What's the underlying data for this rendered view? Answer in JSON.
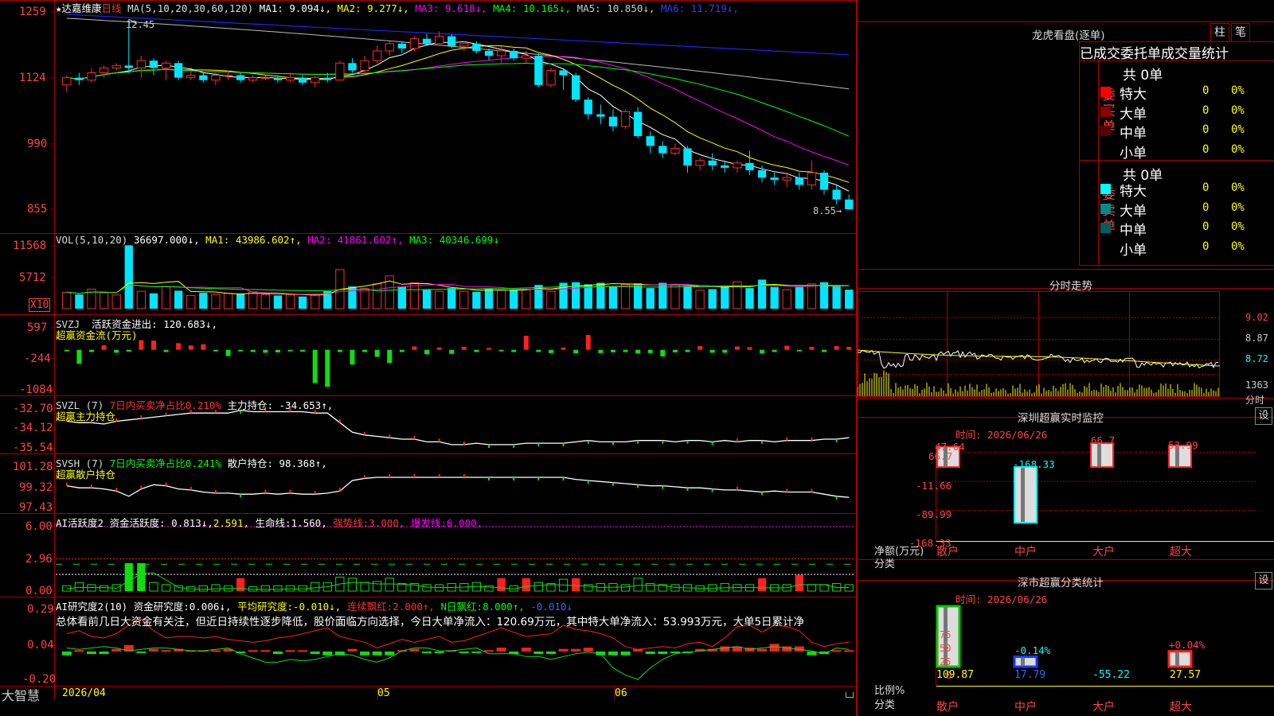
{
  "header": {
    "star": "★",
    "stock_name": "达嘉维康",
    "period": "日线",
    "ma_text": "MA(5,10,20,30,60,120)",
    "ma_values": [
      {
        "label": "MA1:",
        "value": "9.094↓",
        "color": "#ffffff"
      },
      {
        "label": "MA2:",
        "value": "9.277↓",
        "color": "#ffff00"
      },
      {
        "label": "MA3:",
        "value": "9.618↓",
        "color": "#ff00ff"
      },
      {
        "label": "MA4:",
        "value": "10.165↓",
        "color": "#00ff00"
      },
      {
        "label": "MA5:",
        "value": "10.850↓",
        "color": "#cccccc"
      },
      {
        "label": "MA6:",
        "value": "11.719↓",
        "color": "#3a3aff"
      }
    ],
    "high_label": "12.45",
    "low_label": "8.55→"
  },
  "axes": {
    "price_ticks": [
      "1259",
      "1124",
      "990",
      "855"
    ],
    "vol_ticks": [
      "11568",
      "5712"
    ],
    "vol_unit": "X10",
    "svzj_ticks": [
      "597",
      "-244",
      "-1084"
    ],
    "svzl_ticks": [
      "-32.70",
      "-34.12",
      "-35.54"
    ],
    "svsh_ticks": [
      "101.28",
      "99.32",
      "97.43"
    ],
    "ai1_ticks": [
      "6.00",
      "2.96",
      "0.00"
    ],
    "ai2_ticks": [
      "0.29",
      "0.04",
      "-0.20"
    ],
    "dates": [
      "2026/04",
      "05",
      "06"
    ]
  },
  "vol_header": {
    "text": "VOL(5,10,20)",
    "value": "36697.000↓,",
    "items": [
      {
        "label": "MA1:",
        "value": "43986.602↑,",
        "color": "#ffff00"
      },
      {
        "label": "MA2:",
        "value": "41861.602↑,",
        "color": "#ff00ff"
      },
      {
        "label": "MA3:",
        "value": "40346.699↓",
        "color": "#00ff00"
      }
    ]
  },
  "svzj_header": {
    "name": "SVZJ",
    "label": "活跃资金进出:",
    "value": "120.683↓,",
    "sub": "超赢资金流(万元)"
  },
  "svzl_header": {
    "name": "SVZL",
    "param": "(7)",
    "ratio": "7日内买卖净占比0.210%",
    "label": "主力持仓:",
    "value": "-34.653↑,",
    "sub": "超赢主力持仓"
  },
  "svsh_header": {
    "name": "SVSH",
    "param": "(7)",
    "ratio": "7日内买卖净占比0.241%",
    "label": "散户持仓:",
    "value": "98.368↑,",
    "sub": "超赢散户持仓"
  },
  "ai1_header": {
    "name": "AI活跃度2",
    "label": "资金活跃度:",
    "v1": "0.813↓,",
    "v2": "2.591,",
    "life": "生命线:",
    "life_v": "1.560,",
    "strong": "强势线:",
    "strong_v": "3.000,",
    "burst": "爆发线:",
    "burst_v": "6.000,"
  },
  "ai2_header": {
    "name": "AI研究度2(10)",
    "label": "资金研究度:",
    "v1": "0.006↓,",
    "avg": "平均研究度:",
    "avg_v": "-0.010↓,",
    "cont": "连续飘红:",
    "cont_v": "2.000↑,",
    "n": "N日飘红:",
    "n_v": "8.000↑,",
    "last": "-0.010↓"
  },
  "summary_text": "总体看前几日大资金有关注，但近日持续性逐步降低，股价面临方向选择，今日大单净流入：120.69万元，其中特大单净流入：53.993万元，大单5日累计净",
  "brand": "大智慧",
  "right": {
    "title": "龙虎看盘(逐单)",
    "btn1": "柱",
    "btn2": "笔",
    "tab_text": "已成交委托单成交量统计",
    "buy_label": "委买单",
    "sell_label": "委卖单",
    "buy_total": "共 0单",
    "sell_total": "共 0单",
    "buy_rows": [
      {
        "name": "特大",
        "count": "0",
        "pct": "0%",
        "color": "#ff0000"
      },
      {
        "name": "大单",
        "count": "0",
        "pct": "0%",
        "color": "#8b0000"
      },
      {
        "name": "中单",
        "count": "0",
        "pct": "0%",
        "color": "#5a0000"
      },
      {
        "name": "小单",
        "count": "0",
        "pct": "0%",
        "color": ""
      }
    ],
    "sell_rows": [
      {
        "name": "特大",
        "count": "0",
        "pct": "0%",
        "color": "#00ffff"
      },
      {
        "name": "大单",
        "count": "0",
        "pct": "0%",
        "color": "#008b8b"
      },
      {
        "name": "中单",
        "count": "0",
        "pct": "0%",
        "color": "#006060"
      },
      {
        "name": "小单",
        "count": "0",
        "pct": "0%",
        "color": ""
      }
    ],
    "intraday_title": "分时走势",
    "intraday_ticks": [
      "9.02",
      "8.87",
      "8.72",
      "1363"
    ],
    "intraday_unit": "分时",
    "monitor_title": "深圳超赢实时监控",
    "monitor_btn": "设",
    "monitor_time": "时间: 2026/06/26",
    "monitor_ticks": [
      "66.7",
      "-11.66",
      "-89.99",
      "-168.33"
    ],
    "monitor_unit1": "净额(万元)",
    "monitor_unit2": "分类",
    "monitor_bar_labels": [
      "47.64",
      "-168.33",
      "66.7",
      "53.99"
    ],
    "categories": [
      "散户",
      "中户",
      "大户",
      "超大"
    ],
    "stats_title": "深市超赢分类统计",
    "stats_btn": "设",
    "stats_time": "时间: 2026/06/26",
    "stats_ticks": [
      "75",
      "50",
      "25",
      "0"
    ],
    "stats_bar_labels": [
      "",
      "-0.14%",
      "",
      "+0.04%"
    ],
    "stats_unit1": "比例%",
    "stats_unit2": "分类",
    "stats_values": [
      "109.87",
      "17.79",
      "-55.22",
      "27.57"
    ]
  },
  "chart_data": [
    {
      "type": "candlestick",
      "title": "达嘉维康 日线",
      "ylim": [
        8.2,
        12.8
      ],
      "candles": [
        [
          11.1,
          11.25,
          11.3,
          10.95
        ],
        [
          11.25,
          11.2,
          11.35,
          11.1
        ],
        [
          11.2,
          11.35,
          11.45,
          11.15
        ],
        [
          11.35,
          11.45,
          11.5,
          11.25
        ],
        [
          11.45,
          11.5,
          11.55,
          11.4
        ],
        [
          11.5,
          11.45,
          12.45,
          11.35
        ],
        [
          11.45,
          11.6,
          11.7,
          11.25
        ],
        [
          11.6,
          11.45,
          11.65,
          11.3
        ],
        [
          11.45,
          11.55,
          11.6,
          11.2
        ],
        [
          11.55,
          11.25,
          11.6,
          11.2
        ],
        [
          11.25,
          11.3,
          11.4,
          11.2
        ],
        [
          11.3,
          11.2,
          11.35,
          11.15
        ],
        [
          11.2,
          11.3,
          11.35,
          11.1
        ],
        [
          11.3,
          11.3,
          11.4,
          11.2
        ],
        [
          11.3,
          11.2,
          11.35,
          11.15
        ],
        [
          11.2,
          11.25,
          11.3,
          11.15
        ],
        [
          11.25,
          11.25,
          11.3,
          11.2
        ],
        [
          11.25,
          11.2,
          11.3,
          11.15
        ],
        [
          11.2,
          11.25,
          11.35,
          11.15
        ],
        [
          11.25,
          11.15,
          11.3,
          11.1
        ],
        [
          11.15,
          11.25,
          11.3,
          11.05
        ],
        [
          11.25,
          11.2,
          11.35,
          11.15
        ],
        [
          11.2,
          11.55,
          11.6,
          11.2
        ],
        [
          11.55,
          11.4,
          11.65,
          11.35
        ],
        [
          11.4,
          11.6,
          11.7,
          11.35
        ],
        [
          11.6,
          11.8,
          11.9,
          11.55
        ],
        [
          11.8,
          11.95,
          12.0,
          11.7
        ],
        [
          11.95,
          11.85,
          12.0,
          11.75
        ],
        [
          11.85,
          12.05,
          12.1,
          11.8
        ],
        [
          12.05,
          11.95,
          12.15,
          11.9
        ],
        [
          11.95,
          12.1,
          12.2,
          11.95
        ],
        [
          12.1,
          11.9,
          12.15,
          11.85
        ],
        [
          11.9,
          11.95,
          12.0,
          11.8
        ],
        [
          11.95,
          11.8,
          12.0,
          11.75
        ],
        [
          11.8,
          11.7,
          11.85,
          11.6
        ],
        [
          11.7,
          11.8,
          11.9,
          11.55
        ],
        [
          11.8,
          11.65,
          11.85,
          11.6
        ],
        [
          11.65,
          11.7,
          11.8,
          11.55
        ],
        [
          11.7,
          11.1,
          11.75,
          11.05
        ],
        [
          11.1,
          11.4,
          11.45,
          11.05
        ],
        [
          11.4,
          11.3,
          11.45,
          11.0
        ],
        [
          11.3,
          10.8,
          11.35,
          10.75
        ],
        [
          10.8,
          10.5,
          10.85,
          10.4
        ],
        [
          10.5,
          10.45,
          10.7,
          10.3
        ],
        [
          10.45,
          10.25,
          10.6,
          10.15
        ],
        [
          10.25,
          10.55,
          10.6,
          10.2
        ],
        [
          10.55,
          10.05,
          10.65,
          10.0
        ],
        [
          10.05,
          9.85,
          10.15,
          9.7
        ],
        [
          9.85,
          9.7,
          9.95,
          9.6
        ],
        [
          9.7,
          9.8,
          9.9,
          9.65
        ],
        [
          9.8,
          9.45,
          9.85,
          9.3
        ],
        [
          9.45,
          9.55,
          9.6,
          9.35
        ],
        [
          9.55,
          9.45,
          9.7,
          9.35
        ],
        [
          9.45,
          9.4,
          9.55,
          9.3
        ],
        [
          9.4,
          9.5,
          9.55,
          9.3
        ],
        [
          9.5,
          9.35,
          9.75,
          9.25
        ],
        [
          9.35,
          9.2,
          9.45,
          9.1
        ],
        [
          9.2,
          9.15,
          9.3,
          9.05
        ],
        [
          9.15,
          9.2,
          9.3,
          9.0
        ],
        [
          9.2,
          9.05,
          9.3,
          8.95
        ],
        [
          9.05,
          9.3,
          9.55,
          8.95
        ],
        [
          9.3,
          8.95,
          9.35,
          8.85
        ],
        [
          8.95,
          8.75,
          9.05,
          8.65
        ],
        [
          8.75,
          8.55,
          8.85,
          8.55
        ]
      ],
      "ma_colors": [
        "#ffffff",
        "#ffff00",
        "#ff00ff",
        "#00ff00",
        "#bbbbbb",
        "#2222ff"
      ]
    },
    {
      "type": "bar",
      "title": "VOL(5,10,20)",
      "ylim": [
        0,
        14000
      ],
      "values": [
        3100,
        2700,
        3700,
        3000,
        2600,
        12000,
        3300,
        2900,
        4200,
        3400,
        2500,
        3000,
        2700,
        2900,
        2800,
        3200,
        2700,
        2500,
        2600,
        2300,
        2700,
        3300,
        7400,
        4200,
        3800,
        4700,
        6200,
        4200,
        4900,
        3700,
        3300,
        3900,
        3300,
        3200,
        3800,
        3500,
        3600,
        3700,
        4500,
        3300,
        4900,
        5000,
        4600,
        4900,
        4300,
        4600,
        4800,
        3900,
        4900,
        4500,
        4300,
        3500,
        3700,
        4400,
        5100,
        3900,
        5500,
        4100,
        3600,
        4100,
        4700,
        5000,
        4200,
        3600
      ]
    },
    {
      "type": "bar",
      "title": "SVZJ",
      "ylim": [
        -1084,
        597
      ],
      "values": [
        -40,
        -380,
        -60,
        120,
        -80,
        -50,
        260,
        250,
        -60,
        180,
        120,
        150,
        -20,
        -170,
        -30,
        -60,
        -80,
        -70,
        -40,
        -50,
        -900,
        -1000,
        -60,
        -400,
        -60,
        -190,
        -360,
        -60,
        90,
        -120,
        60,
        -110,
        80,
        -60,
        50,
        -20,
        -60,
        380,
        -60,
        -90,
        60,
        -100,
        400,
        -90,
        -70,
        -60,
        -100,
        -90,
        -180,
        -70,
        -60,
        100,
        -80,
        -80,
        90,
        70,
        -100,
        -60,
        110,
        -40,
        80,
        -60,
        100,
        80
      ]
    },
    {
      "type": "line",
      "title": "SVZL",
      "ylim": [
        -35.8,
        -32.3
      ],
      "values": [
        -33.6,
        -33.7,
        -33.7,
        -33.8,
        -33.6,
        -33.5,
        -33.4,
        -33.3,
        -33.2,
        -33.1,
        -33.0,
        -33.0,
        -33.0,
        -33.0,
        -32.8,
        -32.9,
        -32.9,
        -32.9,
        -32.9,
        -32.9,
        -33.0,
        -33.0,
        -33.7,
        -34.4,
        -34.6,
        -34.7,
        -34.8,
        -34.9,
        -34.9,
        -35.1,
        -35.1,
        -35.3,
        -35.3,
        -35.2,
        -35.3,
        -35.3,
        -35.3,
        -35.2,
        -35.2,
        -35.2,
        -35.2,
        -35.1,
        -35.0,
        -35.1,
        -35.1,
        -35.1,
        -35.0,
        -35.0,
        -35.0,
        -35.1,
        -35.0,
        -35.0,
        -35.1,
        -35.0,
        -35.1,
        -35.0,
        -35.0,
        -35.1,
        -35.0,
        -35.0,
        -35.0,
        -34.9,
        -34.9,
        -34.8
      ]
    },
    {
      "type": "line",
      "title": "SVSH",
      "ylim": [
        97.1,
        101.7
      ],
      "values": [
        99.5,
        99.3,
        99.3,
        99.2,
        99.0,
        98.5,
        99.2,
        99.6,
        99.5,
        99.2,
        99.1,
        98.9,
        98.8,
        98.8,
        98.7,
        98.7,
        98.8,
        98.7,
        98.8,
        98.7,
        98.7,
        98.8,
        99.0,
        100.0,
        100.2,
        100.3,
        100.3,
        100.3,
        100.3,
        100.3,
        100.3,
        100.3,
        100.3,
        100.3,
        100.3,
        100.3,
        100.3,
        100.3,
        100.3,
        100.3,
        100.3,
        100.1,
        100.0,
        99.9,
        99.8,
        99.7,
        99.6,
        99.5,
        99.5,
        99.4,
        99.3,
        99.3,
        99.2,
        99.1,
        99.1,
        99.0,
        98.9,
        99.0,
        98.9,
        98.9,
        98.9,
        98.7,
        98.5,
        98.4
      ]
    },
    {
      "type": "bar",
      "title": "AI活跃度2",
      "ylim": [
        0,
        6.2
      ],
      "lines": {
        "life": 1.56,
        "strong": 3.0,
        "burst": 6.0
      },
      "values": [
        0.5,
        0.8,
        0.6,
        0.5,
        0.6,
        2.6,
        2.6,
        0.8,
        0.6,
        0.5,
        0.4,
        0.5,
        0.6,
        0.5,
        0.5,
        0.4,
        0.5,
        0.5,
        0.5,
        0.5,
        0.8,
        0.8,
        1.3,
        1.2,
        0.8,
        0.9,
        1.2,
        0.7,
        0.7,
        0.6,
        0.6,
        0.7,
        0.7,
        0.8,
        0.5,
        0.5,
        0.5,
        1.2,
        0.8,
        0.7,
        1.1,
        0.6,
        0.6,
        0.7,
        0.7,
        0.6,
        1.2,
        0.7,
        0.6,
        0.6,
        0.6,
        0.5,
        0.6,
        0.7,
        0.6,
        0.6,
        0.6,
        0.6,
        0.6,
        1.5,
        0.6,
        0.6,
        0.7,
        0.6
      ],
      "red_flags": [
        0,
        0,
        0,
        0,
        0,
        0,
        0,
        0,
        0,
        0,
        0,
        0,
        0,
        0,
        1,
        0,
        0,
        0,
        0,
        0,
        0,
        0,
        0,
        0,
        0,
        0,
        0,
        0,
        0,
        0,
        0,
        0,
        0,
        0,
        0,
        1,
        0,
        1,
        0,
        0,
        0,
        1,
        0,
        0,
        0,
        0,
        0,
        0,
        0,
        0,
        0,
        0,
        0,
        0,
        0,
        0,
        1,
        0,
        0,
        1,
        0,
        0,
        0,
        0
      ]
    },
    {
      "type": "bar",
      "title": "AI研究度2(10)",
      "ylim": [
        -0.22,
        0.31
      ],
      "values": [
        -0.03,
        0.01,
        -0.02,
        -0.02,
        0.02,
        0.05,
        -0.01,
        0.02,
        0.01,
        0.02,
        0.01,
        0.01,
        0.01,
        0.02,
        -0.01,
        0.01,
        0.01,
        -0.02,
        0.01,
        0.01,
        -0.02,
        -0.03,
        -0.03,
        0.02,
        -0.03,
        -0.03,
        -0.03,
        0.01,
        0.02,
        -0.01,
        -0.01,
        0.01,
        -0.01,
        -0.01,
        0.01,
        0.03,
        -0.02,
        0.03,
        -0.02,
        -0.02,
        0.02,
        0.02,
        0.03,
        -0.03,
        -0.03,
        -0.03,
        0.02,
        -0.02,
        -0.02,
        -0.01,
        -0.01,
        0.02,
        0.02,
        0.04,
        0.04,
        0.03,
        0.02,
        0.06,
        0.04,
        0.04,
        -0.03,
        -0.02,
        0.01,
        0.01
      ]
    }
  ]
}
